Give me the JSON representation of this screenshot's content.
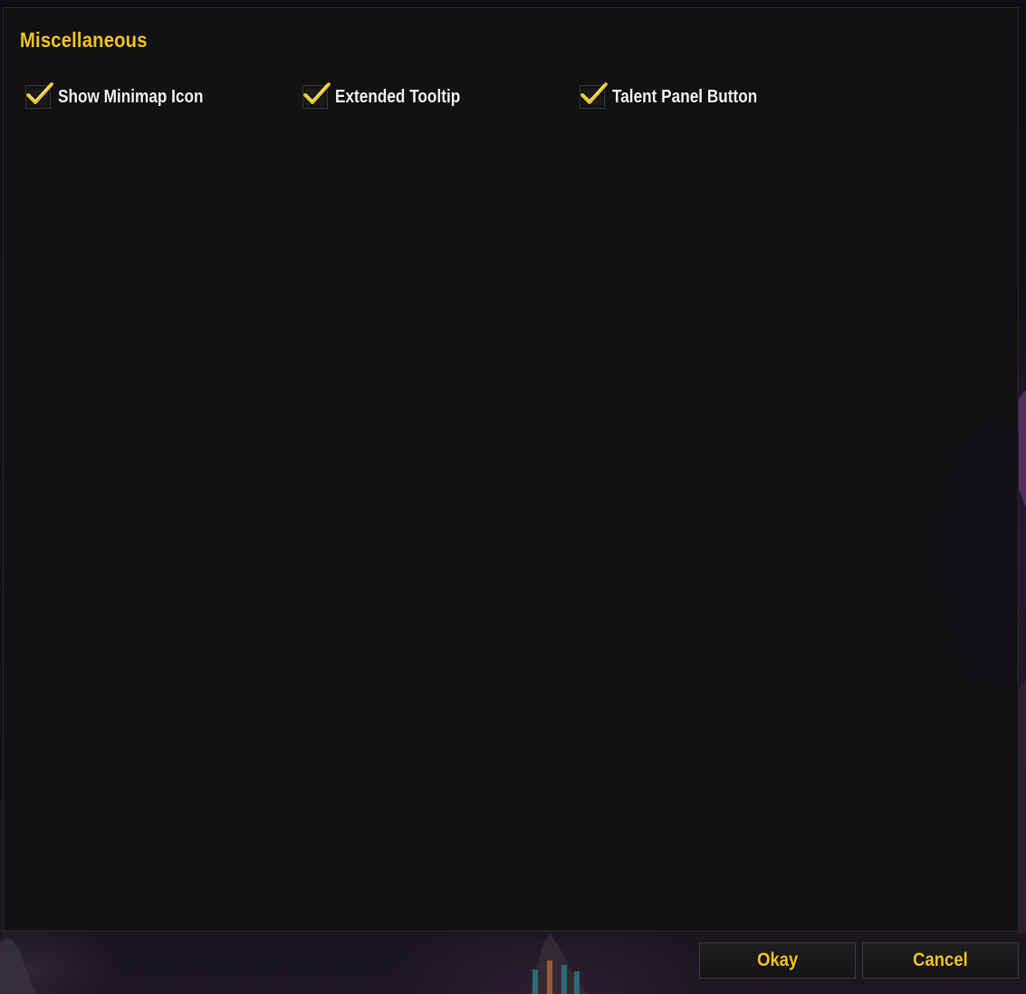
{
  "panel": {
    "section_title": "Miscellaneous",
    "options": [
      {
        "label": "Show Minimap Icon",
        "checked": true,
        "icon": "checkmark-icon"
      },
      {
        "label": "Extended Tooltip",
        "checked": true,
        "icon": "checkmark-icon"
      },
      {
        "label": "Talent Panel Button",
        "checked": true,
        "icon": "checkmark-icon"
      }
    ]
  },
  "footer": {
    "okay_label": "Okay",
    "cancel_label": "Cancel"
  },
  "colors": {
    "accent_gold": "#f5c41c",
    "label_white": "#f2f2f2",
    "panel_bg": "#121214"
  }
}
